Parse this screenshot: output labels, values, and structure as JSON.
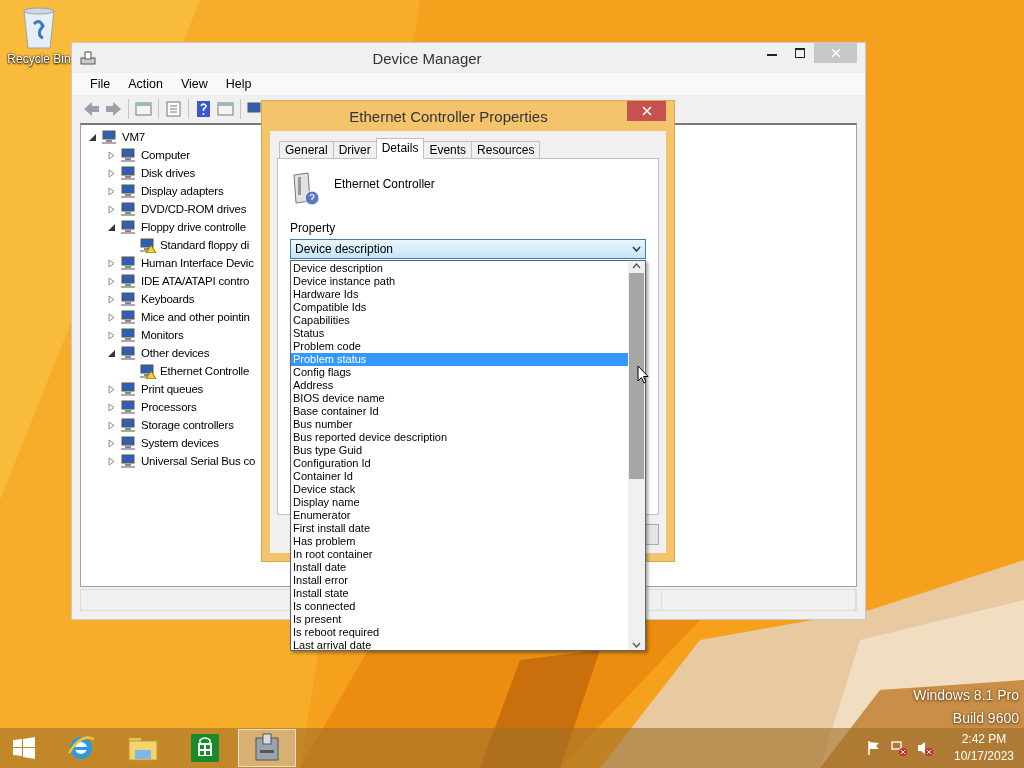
{
  "desktop": {
    "icons": [
      {
        "label": "Recycle Bin"
      }
    ],
    "watermark": [
      "Windows 8.1 Pro",
      "Build 9600"
    ]
  },
  "device_manager": {
    "title": "Device Manager",
    "menu": [
      "File",
      "Action",
      "View",
      "Help"
    ],
    "tree": {
      "label": "VM7",
      "expanded": true,
      "children": [
        {
          "label": "Computer",
          "expanded": false
        },
        {
          "label": "Disk drives",
          "expanded": false
        },
        {
          "label": "Display adapters",
          "expanded": false
        },
        {
          "label": "DVD/CD-ROM drives",
          "expanded": false
        },
        {
          "label": "Floppy drive controlle",
          "expanded": true,
          "children": [
            {
              "label": "Standard floppy di",
              "warning": true
            }
          ]
        },
        {
          "label": "Human Interface Devic",
          "expanded": false
        },
        {
          "label": "IDE ATA/ATAPI contro",
          "expanded": false
        },
        {
          "label": "Keyboards",
          "expanded": false
        },
        {
          "label": "Mice and other pointin",
          "expanded": false
        },
        {
          "label": "Monitors",
          "expanded": false
        },
        {
          "label": "Other devices",
          "expanded": true,
          "children": [
            {
              "label": "Ethernet Controlle",
              "warning": true
            }
          ]
        },
        {
          "label": "Print queues",
          "expanded": false
        },
        {
          "label": "Processors",
          "expanded": false
        },
        {
          "label": "Storage controllers",
          "expanded": false
        },
        {
          "label": "System devices",
          "expanded": false
        },
        {
          "label": "Universal Serial Bus co",
          "expanded": false
        }
      ]
    }
  },
  "properties_dialog": {
    "title": "Ethernet Controller Properties",
    "tabs": [
      {
        "label": "General",
        "selected": false
      },
      {
        "label": "Driver",
        "selected": false
      },
      {
        "label": "Details",
        "selected": true
      },
      {
        "label": "Events",
        "selected": false
      },
      {
        "label": "Resources",
        "selected": false
      }
    ],
    "device_name": "Ethernet Controller",
    "property_label": "Property",
    "property_select": {
      "value": "Device description"
    },
    "options": [
      {
        "label": "Device description",
        "selected": false
      },
      {
        "label": "Device instance path",
        "selected": false
      },
      {
        "label": "Hardware Ids",
        "selected": false
      },
      {
        "label": "Compatible Ids",
        "selected": false
      },
      {
        "label": "Capabilities",
        "selected": false
      },
      {
        "label": "Status",
        "selected": false
      },
      {
        "label": "Problem code",
        "selected": false
      },
      {
        "label": "Problem status",
        "selected": true
      },
      {
        "label": "Config flags",
        "selected": false
      },
      {
        "label": "Address",
        "selected": false
      },
      {
        "label": "BIOS device name",
        "selected": false
      },
      {
        "label": "Base container Id",
        "selected": false
      },
      {
        "label": "Bus number",
        "selected": false
      },
      {
        "label": "Bus reported device description",
        "selected": false
      },
      {
        "label": "Bus type Guid",
        "selected": false
      },
      {
        "label": "Configuration Id",
        "selected": false
      },
      {
        "label": "Container Id",
        "selected": false
      },
      {
        "label": "Device stack",
        "selected": false
      },
      {
        "label": "Display name",
        "selected": false
      },
      {
        "label": "Enumerator",
        "selected": false
      },
      {
        "label": "First install date",
        "selected": false
      },
      {
        "label": "Has problem",
        "selected": false
      },
      {
        "label": "In root container",
        "selected": false
      },
      {
        "label": "Install date",
        "selected": false
      },
      {
        "label": "Install error",
        "selected": false
      },
      {
        "label": "Install state",
        "selected": false
      },
      {
        "label": "Is connected",
        "selected": false
      },
      {
        "label": "Is present",
        "selected": false
      },
      {
        "label": "Is reboot required",
        "selected": false
      },
      {
        "label": "Last arrival date",
        "selected": false
      }
    ]
  },
  "taskbar": {
    "apps": [
      {
        "kind": "start",
        "selected": false
      },
      {
        "kind": "browser",
        "selected": false
      },
      {
        "kind": "folder",
        "selected": false
      },
      {
        "kind": "store",
        "selected": false
      },
      {
        "kind": "device-manager",
        "selected": true
      }
    ],
    "clock": {
      "time": "2:42 PM",
      "date": "10/17/2023"
    }
  }
}
